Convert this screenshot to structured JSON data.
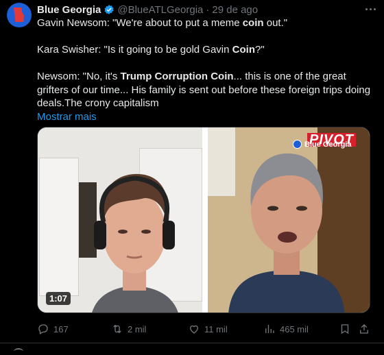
{
  "author": {
    "name": "Blue Georgia",
    "handle": "@BlueATLGeorgia",
    "separator": "·",
    "date": "29 de ago",
    "avatar_color": "#1d5fd6"
  },
  "text": {
    "line1_pre": "Gavin Newsom: \"We're about to put a meme ",
    "line1_bold": "coin",
    "line1_post": " out.\"",
    "line2_pre": "Kara Swisher: \"Is it going to be gold Gavin ",
    "line2_bold": "Coin",
    "line2_post": "?\"",
    "line3_pre": "Newsom: \"No, it's ",
    "line3_bold": "Trump Corruption Coin",
    "line3_post": "... this is one of the great grifters of our time... His family is sent out before these foreign trips doing deals.The crony capitalism",
    "show_more": "Mostrar mais"
  },
  "media": {
    "logo": "PIVOT",
    "watermark": "Blue Georgia",
    "duration": "1:07"
  },
  "actions": {
    "replies": "167",
    "reposts": "2 mil",
    "likes": "11 mil",
    "views": "465 mil"
  },
  "colors": {
    "accent": "#1d9bf0",
    "muted": "#71767b",
    "background": "#000000"
  },
  "icons": [
    "verified-badge-icon",
    "more-icon",
    "reply-icon",
    "repost-icon",
    "like-icon",
    "views-icon",
    "bookmark-icon",
    "share-icon"
  ]
}
